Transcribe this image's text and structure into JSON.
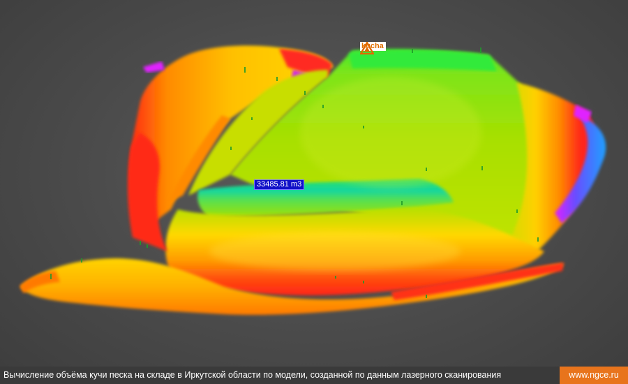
{
  "scene": {
    "marker": {
      "icon": "warning-triangle-icon",
      "label": "kucha"
    },
    "volume_label": "33485.81 m3",
    "colors": {
      "background": "#4a4a4a",
      "low_red": "#ff2020",
      "mid_orange": "#ff9a00",
      "mid_yellow": "#ffd400",
      "upper_lime": "#b4e400",
      "top_green": "#2ce83a",
      "peak_cyan": "#18d8a8",
      "deep_blue": "#1e6aff",
      "magenta": "#e020ff"
    }
  },
  "footer": {
    "caption": "Вычисление объёма кучи песка на складе в Иркутской области по модели, созданной по данным лазерного сканирования",
    "site": "www.ngce.ru",
    "caption_bg": "#3a3a3a",
    "site_bg": "#e8741c"
  }
}
